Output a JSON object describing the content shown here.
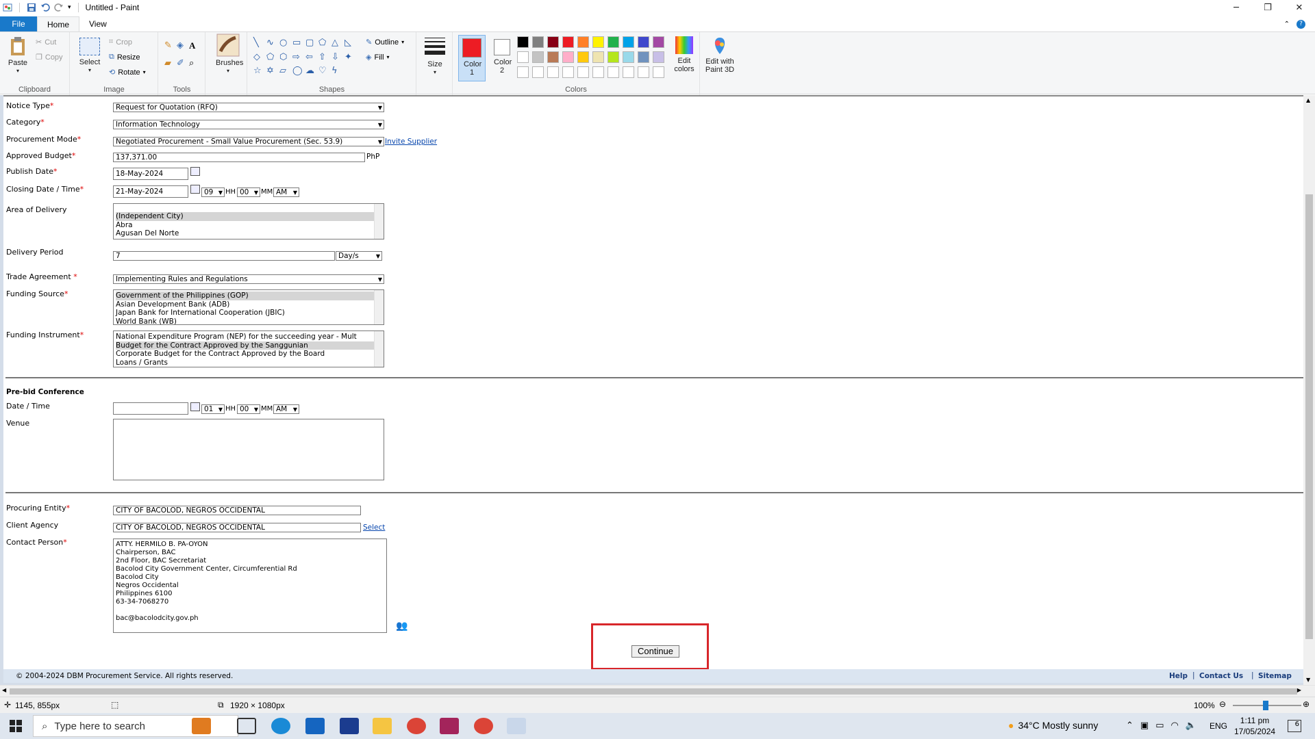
{
  "window": {
    "title": "Untitled - Paint"
  },
  "menu": {
    "file": "File",
    "home": "Home",
    "view": "View"
  },
  "ribbon": {
    "clipboard": {
      "label": "Clipboard",
      "paste": "Paste",
      "cut": "Cut",
      "copy": "Copy"
    },
    "image": {
      "label": "Image",
      "select": "Select",
      "crop": "Crop",
      "resize": "Resize",
      "rotate": "Rotate"
    },
    "tools": {
      "label": "Tools"
    },
    "brushes": {
      "label": "Brushes"
    },
    "shapes": {
      "label": "Shapes",
      "outline": "Outline",
      "fill": "Fill"
    },
    "size": {
      "label": "Size"
    },
    "colors": {
      "label": "Colors",
      "color1": "Color 1",
      "color2": "Color 2",
      "edit": "Edit colors",
      "paint3d": "Edit with Paint 3D",
      "palette_row1": [
        "#000000",
        "#7f7f7f",
        "#880015",
        "#ed1c24",
        "#ff7f27",
        "#fff200",
        "#22b14c",
        "#00a2e8",
        "#3f48cc",
        "#a349a4"
      ],
      "palette_row2": [
        "#ffffff",
        "#c3c3c3",
        "#b97a57",
        "#ffaec9",
        "#ffc90e",
        "#efe4b0",
        "#b5e61d",
        "#99d9ea",
        "#7092be",
        "#c8bfe7"
      ],
      "primary": "#ed1c24",
      "secondary": "#ffffff"
    }
  },
  "form": {
    "notice_type": {
      "label": "Notice Type",
      "value": "Request for Quotation (RFQ)"
    },
    "category": {
      "label": "Category",
      "value": "Information Technology"
    },
    "procurement_mode": {
      "label": "Procurement Mode",
      "value": "Negotiated Procurement - Small Value Procurement (Sec. 53.9)",
      "link": "Invite Supplier"
    },
    "approved_budget": {
      "label": "Approved Budget",
      "value": "137,371.00",
      "unit": "PhP"
    },
    "publish_date": {
      "label": "Publish Date",
      "value": "18-May-2024"
    },
    "closing": {
      "label": "Closing Date / Time",
      "date": "21-May-2024",
      "hh": "09",
      "mm": "00",
      "ampm": "AM",
      "hh_label": "HH",
      "mm_label": "MM"
    },
    "area_of_delivery": {
      "label": "Area of Delivery",
      "items": [
        "(Independent City)",
        "Abra",
        "Agusan Del Norte"
      ]
    },
    "delivery_period": {
      "label": "Delivery Period",
      "value": "7",
      "unit": "Day/s"
    },
    "trade_agreement": {
      "label": "Trade Agreement",
      "value": "Implementing Rules and Regulations"
    },
    "funding_source": {
      "label": "Funding Source",
      "items": [
        "Government of the Philippines (GOP)",
        "Asian Development Bank (ADB)",
        "Japan Bank for International Cooperation (JBIC)",
        "World Bank (WB)"
      ]
    },
    "funding_instrument": {
      "label": "Funding Instrument",
      "items": [
        "National Expenditure Program (NEP) for the succeeding year - Mult",
        "Budget for the Contract Approved by the Sanggunian",
        "Corporate Budget for the Contract Approved by the Board",
        "Loans / Grants"
      ]
    },
    "prebid": {
      "heading": "Pre-bid Conference",
      "datetime_label": "Date / Time",
      "hh": "01",
      "mm": "00",
      "ampm": "AM",
      "venue_label": "Venue"
    },
    "procuring_entity": {
      "label": "Procuring Entity",
      "value": "CITY OF BACOLOD, NEGROS OCCIDENTAL"
    },
    "client_agency": {
      "label": "Client Agency",
      "value": "CITY OF BACOLOD, NEGROS OCCIDENTAL",
      "link": "Select"
    },
    "contact_person": {
      "label": "Contact Person",
      "lines": [
        "ATTY. HERMILO B. PA-OYON",
        "Chairperson, BAC",
        "2nd Floor, BAC Secretariat",
        "Bacolod City Government Center, Circumferential Rd",
        "Bacolod City",
        "Negros Occidental",
        "Philippines 6100",
        "63-34-7068270",
        "",
        "bac@bacolodcity.gov.ph"
      ]
    },
    "continue": "Continue",
    "footer": {
      "copyright": "© 2004-2024  DBM Procurement Service. All rights reserved.",
      "help": "Help",
      "contact": "Contact Us",
      "sitemap": "Sitemap"
    }
  },
  "status": {
    "cursor": "1145, 855px",
    "size": "1920 × 1080px",
    "zoom": "100%"
  },
  "taskbar": {
    "search": "Type here to search",
    "weather": "34°C  Mostly sunny",
    "lang": "ENG",
    "time": "1:11 pm",
    "date": "17/05/2024",
    "notif": "6"
  }
}
